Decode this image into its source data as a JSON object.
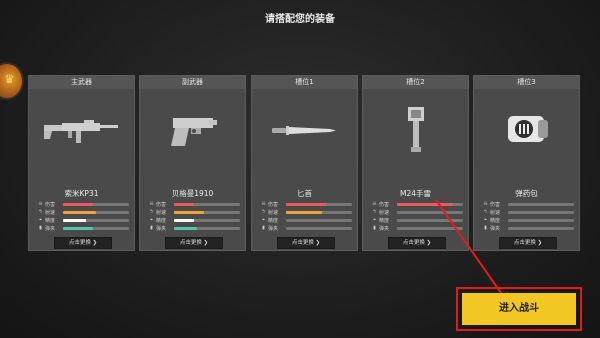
{
  "title": "请搭配您的装备",
  "colors": {
    "damage": "#e85b5b",
    "rate": "#f2a23a",
    "accuracy": "#ffffff",
    "recoil": "#56c6a8",
    "accent_button": "#f2c623",
    "highlight_border": "#e31b1b"
  },
  "stat_labels": [
    "伤害",
    "射速",
    "精度",
    "弹夹"
  ],
  "cards": [
    {
      "header": "主武器",
      "name": "索米KP31",
      "icon": "submachine-gun",
      "swap_label": "点击更换 ❯",
      "stats": [
        0.45,
        0.5,
        0.35,
        0.45
      ]
    },
    {
      "header": "副武器",
      "name": "贝格曼1910",
      "icon": "pistol",
      "swap_label": "点击更换 ❯",
      "stats": [
        0.3,
        0.45,
        0.3,
        0.35
      ]
    },
    {
      "header": "槽位1",
      "name": "匕首",
      "icon": "dagger",
      "swap_label": "点击更换 ❯",
      "stats": [
        0.6,
        0.55,
        0.0,
        0.0
      ]
    },
    {
      "header": "槽位2",
      "name": "M24手雷",
      "icon": "stick-grenade",
      "swap_label": "点击更换 ❯",
      "stats": [
        0.85,
        0.0,
        0.0,
        0.0
      ]
    },
    {
      "header": "槽位3",
      "name": "弹药包",
      "icon": "ammo-pack",
      "swap_label": "点击更换 ❯",
      "stats": [
        0.0,
        0.0,
        0.0,
        0.0
      ]
    }
  ],
  "enter_button": "进入战斗"
}
